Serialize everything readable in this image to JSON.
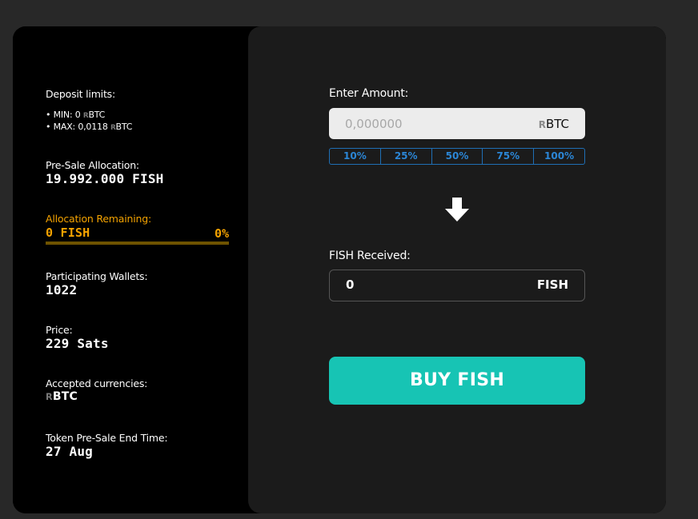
{
  "limits": {
    "title": "Deposit limits:",
    "min_prefix": "• MIN: 0 ",
    "max_prefix": "• MAX: 0,0118 ",
    "currency_mark": "R",
    "currency_code": "BTC"
  },
  "presale": {
    "label": "Pre-Sale Allocation:",
    "value": "19.992.000 FISH"
  },
  "remaining": {
    "label": "Allocation Remaining:",
    "value": "0 FISH",
    "percent_text": "0%",
    "percent": 0
  },
  "wallets": {
    "label": "Participating Wallets:",
    "value": "1022"
  },
  "price": {
    "label": "Price:",
    "value": "229 Sats"
  },
  "accepted": {
    "label": "Accepted currencies:",
    "mark": "R",
    "code": "BTC"
  },
  "end_time": {
    "label": "Token Pre-Sale End Time:",
    "value": "27 Aug"
  },
  "enter": {
    "label": "Enter Amount:",
    "placeholder": "0,000000",
    "unit_mark": "R",
    "unit_code": "BTC"
  },
  "percent_buttons": [
    "10%",
    "25%",
    "50%",
    "75%",
    "100%"
  ],
  "received": {
    "label": "FISH Received:",
    "value": "0",
    "unit": "FISH"
  },
  "buy": {
    "label": "BUY FISH"
  },
  "colors": {
    "accent_teal": "#17c4b4",
    "accent_orange": "#f5a300",
    "accent_blue": "#2b86d6"
  }
}
